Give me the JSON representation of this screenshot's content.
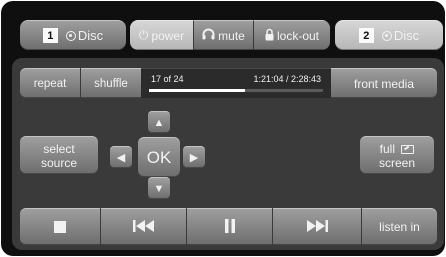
{
  "top_bar": {
    "zone1": {
      "number": "1",
      "source_label": "Disc",
      "icon": "disc-icon"
    },
    "zone2": {
      "number": "2",
      "source_label": "Disc",
      "icon": "disc-icon"
    },
    "power_label": "power",
    "mute_label": "mute",
    "lockout_label": "lock-out",
    "power_icon": "power-icon",
    "mute_icon": "headphones-icon",
    "lockout_icon": "lock-icon"
  },
  "playback": {
    "repeat_label": "repeat",
    "shuffle_label": "shuffle",
    "track_position": "17 of 24",
    "elapsed_total": "1:21:04 / 2:28:43",
    "progress": 0.55,
    "front_media_label": "front media"
  },
  "navigation": {
    "ok_label": "OK",
    "up_icon": "arrow-up-icon",
    "down_icon": "arrow-down-icon",
    "left_icon": "arrow-left-icon",
    "right_icon": "arrow-right-icon",
    "select_source_line1": "select",
    "select_source_line2": "source",
    "full_screen_line1": "full",
    "full_screen_line2": "screen",
    "full_screen_icon": "fullscreen-icon"
  },
  "transport": {
    "stop_icon": "stop-icon",
    "previous_icon": "skip-previous-icon",
    "pause_icon": "pause-icon",
    "next_icon": "skip-next-icon",
    "listen_in_label": "listen in"
  },
  "colors": {
    "background": "#0f0f0f",
    "panel": "#3a3a3a",
    "button": "#8a8a8a",
    "button_light": "#c6c6c6",
    "text": "#f2f2f2"
  }
}
